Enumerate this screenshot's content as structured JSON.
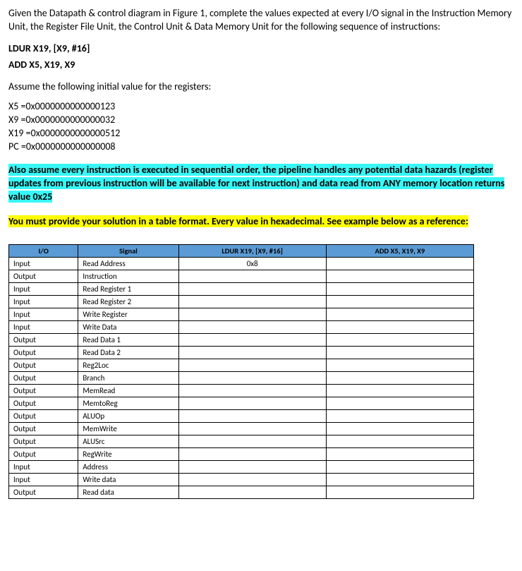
{
  "intro": "Given the Datapath & control diagram in Figure 1, complete the values expected at every I/O signal in the Instruction Memory Unit, the Register File Unit, the Control Unit & Data Memory Unit for the following sequence of instructions:",
  "instructions": {
    "line1": "LDUR X19, [X9, #16]",
    "line2": "ADD X5, X19, X9"
  },
  "assume_label": "Assume the following initial value for the registers:",
  "registers": {
    "x5": "X5   =0x0000000000000123",
    "x9": "X9   =0x0000000000000032",
    "x19": "X19 =0x0000000000000512",
    "pc": "PC   =0x0000000000000008"
  },
  "assumption_p1": "Also assume every instruction is executed in sequential order, the pipeline handles any potential data hazards (register updates from previous instruction will be available for next instruction) and  data read from ANY memory location returns value 0x25",
  "requirement_p1": "You must provide your solution in a table format. Every value in hexadecimal. See example below as a reference",
  "requirement_colon": ":",
  "table": {
    "headers": [
      "I/O",
      "Signal",
      "LDUR X19, [X9, #16]",
      "ADD X5, X19, X9"
    ],
    "rows": [
      {
        "io": "Input",
        "signal": "Read Address",
        "col1": "0x8",
        "col2": ""
      },
      {
        "io": "Output",
        "signal": "Instruction",
        "col1": "",
        "col2": ""
      },
      {
        "io": "Input",
        "signal": "Read Register 1",
        "col1": "",
        "col2": ""
      },
      {
        "io": "Input",
        "signal": "Read Register 2",
        "col1": "",
        "col2": ""
      },
      {
        "io": "Input",
        "signal": "Write Register",
        "col1": "",
        "col2": ""
      },
      {
        "io": "Input",
        "signal": "Write Data",
        "col1": "",
        "col2": ""
      },
      {
        "io": "Output",
        "signal": "Read Data 1",
        "col1": "",
        "col2": ""
      },
      {
        "io": "Output",
        "signal": "Read Data 2",
        "col1": "",
        "col2": ""
      },
      {
        "io": "Output",
        "signal": "Reg2Loc",
        "col1": "",
        "col2": ""
      },
      {
        "io": "Output",
        "signal": "Branch",
        "col1": "",
        "col2": ""
      },
      {
        "io": "Output",
        "signal": "MemRead",
        "col1": "",
        "col2": ""
      },
      {
        "io": "Output",
        "signal": "MemtoReg",
        "col1": "",
        "col2": ""
      },
      {
        "io": "Output",
        "signal": "ALUOp",
        "col1": "",
        "col2": ""
      },
      {
        "io": "Output",
        "signal": "MemWrite",
        "col1": "",
        "col2": ""
      },
      {
        "io": "Output",
        "signal": "ALUSrc",
        "col1": "",
        "col2": ""
      },
      {
        "io": "Output",
        "signal": "RegWrite",
        "col1": "",
        "col2": ""
      },
      {
        "io": "Input",
        "signal": "Address",
        "col1": "",
        "col2": ""
      },
      {
        "io": "Input",
        "signal": "Write data",
        "col1": "",
        "col2": ""
      },
      {
        "io": "Output",
        "signal": "Read data",
        "col1": "",
        "col2": ""
      }
    ]
  }
}
